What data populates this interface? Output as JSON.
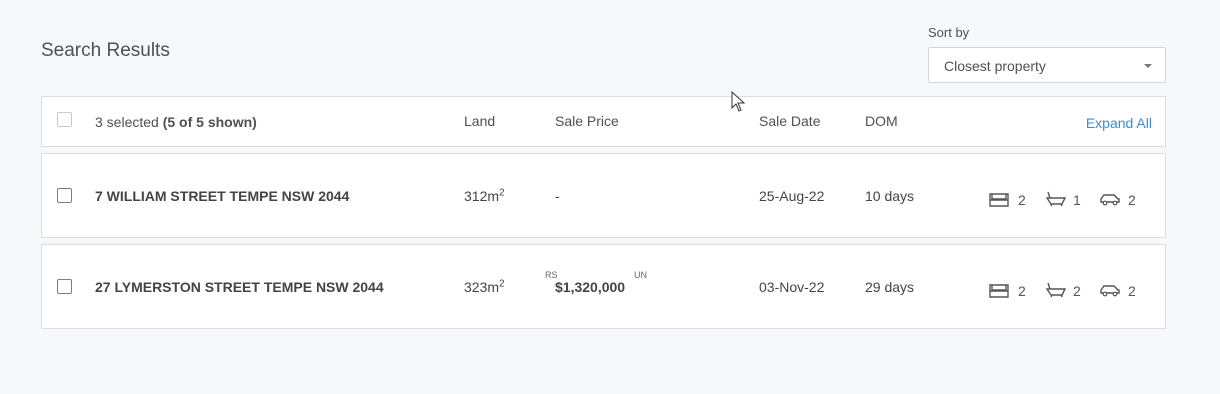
{
  "page": {
    "title": "Search Results"
  },
  "sort": {
    "label": "Sort by",
    "value": "Closest property"
  },
  "list_header": {
    "selected": "3 selected",
    "shown": "(5 of 5 shown)",
    "columns": {
      "land": "Land",
      "sale_price": "Sale Price",
      "sale_date": "Sale Date",
      "dom": "DOM"
    },
    "expand_all": "Expand All"
  },
  "properties": [
    {
      "address": "7 WILLIAM STREET TEMPE NSW 2044",
      "land": "312m",
      "land_unit_sup": "2",
      "sale_price": "-",
      "price_tag_left": "",
      "price_tag_right": "",
      "sale_date": "25-Aug-22",
      "dom": "10 days",
      "beds": "2",
      "baths": "1",
      "cars": "2"
    },
    {
      "address": "27 LYMERSTON STREET TEMPE NSW 2044",
      "land": "323m",
      "land_unit_sup": "2",
      "sale_price": "$1,320,000",
      "price_tag_left": "RS",
      "price_tag_right": "UN",
      "sale_date": "03-Nov-22",
      "dom": "29 days",
      "beds": "2",
      "baths": "2",
      "cars": "2"
    }
  ],
  "colors": {
    "link": "#3b8ed1",
    "background": "#f6f8fb",
    "border": "#dcdcdc"
  },
  "icons": [
    "bed-icon",
    "bath-icon",
    "car-icon",
    "mouse-cursor-icon",
    "chevron-down-icon"
  ]
}
